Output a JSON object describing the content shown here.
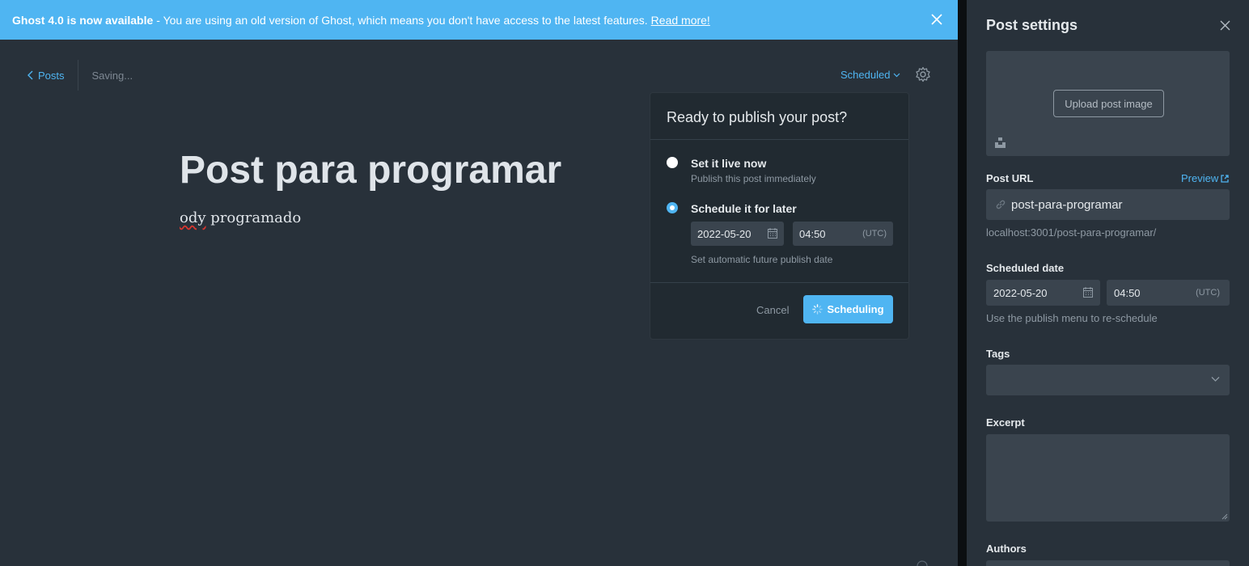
{
  "banner": {
    "strong": "Ghost 4.0 is now available",
    "message": "- You are using an old version of Ghost, which means you don't have access to the latest features.",
    "link": "Read more!",
    "close_icon": "close-icon"
  },
  "topbar": {
    "back_label": "Posts",
    "saving": "Saving...",
    "status": "Scheduled",
    "settings_icon": "gear-icon"
  },
  "post": {
    "title": "Post para programar",
    "body_first": "ody",
    "body_rest": " programado"
  },
  "publish_menu": {
    "title": "Ready to publish your post?",
    "option_now": {
      "label": "Set it live now",
      "desc": "Publish this post immediately",
      "selected": false
    },
    "option_later": {
      "label": "Schedule it for later",
      "selected": true
    },
    "date": "2022-05-20",
    "time": "04:50",
    "tz": "(UTC)",
    "hint": "Set automatic future publish date",
    "cancel": "Cancel",
    "submit": "Scheduling"
  },
  "settings": {
    "title": "Post settings",
    "upload_label": "Upload post image",
    "url_label": "Post URL",
    "preview": "Preview",
    "slug": "post-para-programar",
    "full_url": "localhost:3001/post-para-programar/",
    "scheduled_label": "Scheduled date",
    "date": "2022-05-20",
    "time": "04:50",
    "tz": "(UTC)",
    "reschedule_hint": "Use the publish menu to re-schedule",
    "tags_label": "Tags",
    "excerpt_label": "Excerpt",
    "authors_label": "Authors"
  },
  "colors": {
    "accent": "#4fb5f2",
    "editor_bg": "#28313a",
    "input_bg": "#3a444e",
    "spellcheck": "#d9362f"
  }
}
